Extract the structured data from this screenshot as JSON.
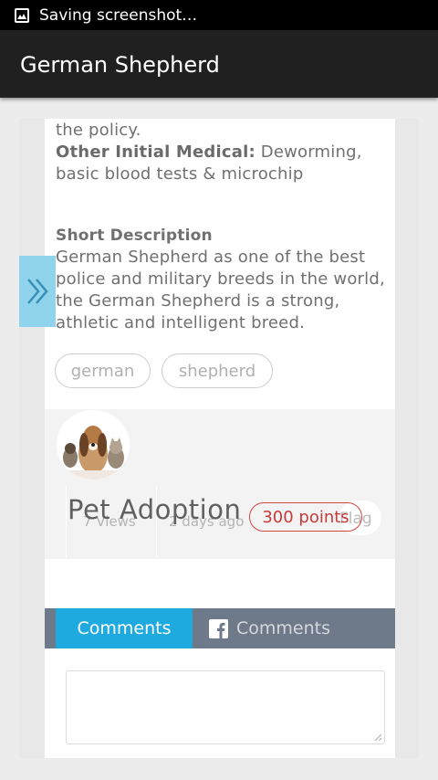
{
  "status_bar": {
    "text": "Saving screenshot…",
    "icon": "image-icon"
  },
  "app_bar": {
    "title": "German Shepherd"
  },
  "details": {
    "policy_tail": "the policy.",
    "medical_label": "Other Initial Medical:",
    "medical_value_line1": " Deworming,",
    "medical_value_line2": "basic blood tests & microchip"
  },
  "short_description": {
    "heading": "Short Description",
    "lines": [
      "German Shepherd as one of the best",
      "police and military breeds in the world,",
      "the German Shepherd is a strong,",
      "athletic and intelligent breed."
    ]
  },
  "tags": [
    "german",
    "shepherd"
  ],
  "side_tab": {
    "icon": "double-chevron-right-icon"
  },
  "author": {
    "avatar": "pets-avatar",
    "name": "Pet Adoption",
    "points": "300 points"
  },
  "stats": {
    "views": "7 Views",
    "posted": "2 days ago",
    "flag": "Flag"
  },
  "comments_tabs": [
    {
      "label": "Comments",
      "active": true
    },
    {
      "label": "Comments",
      "active": false,
      "icon": "facebook-icon"
    }
  ],
  "colors": {
    "accent": "#1ea9df",
    "tab_bar": "#6e7a8a",
    "points": "#d64545",
    "side_tab": "#8fd3ec"
  }
}
